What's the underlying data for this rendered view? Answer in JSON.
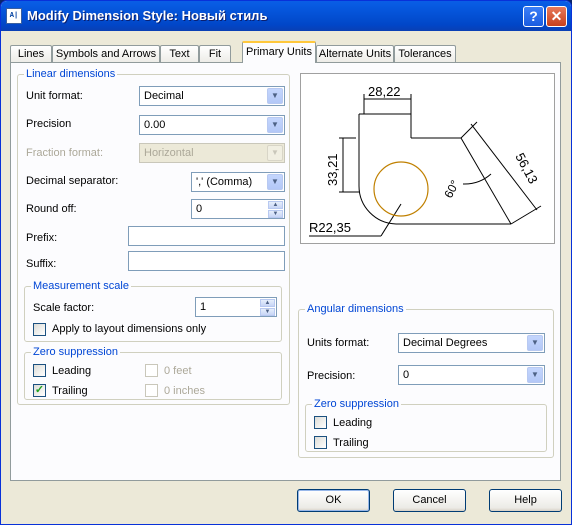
{
  "window": {
    "title": "Modify Dimension Style: Новый стиль",
    "icon": "A|",
    "help_glyph": "?",
    "close_glyph": "✕"
  },
  "tabs": [
    {
      "label": "Lines"
    },
    {
      "label": "Symbols and Arrows"
    },
    {
      "label": "Text"
    },
    {
      "label": "Fit"
    },
    {
      "label": "Primary Units",
      "active": true
    },
    {
      "label": "Alternate Units"
    },
    {
      "label": "Tolerances"
    }
  ],
  "linear": {
    "title": "Linear dimensions",
    "unit_format": {
      "label": "Unit format:",
      "value": "Decimal"
    },
    "precision": {
      "label": "Precision",
      "value": "0.00"
    },
    "fraction_format": {
      "label": "Fraction format:",
      "value": "Horizontal"
    },
    "decimal_separator": {
      "label": "Decimal separator:",
      "value": "',' (Comma)"
    },
    "round_off": {
      "label": "Round off:",
      "value": "0"
    },
    "prefix": {
      "label": "Prefix:",
      "value": ""
    },
    "suffix": {
      "label": "Suffix:",
      "value": ""
    }
  },
  "measurement_scale": {
    "title": "Measurement scale",
    "scale_factor": {
      "label": "Scale factor:",
      "value": "1"
    },
    "apply_layout": {
      "label": "Apply to layout dimensions only",
      "checked": false
    }
  },
  "zero_linear": {
    "title": "Zero suppression",
    "leading": {
      "label": "Leading",
      "checked": false
    },
    "trailing": {
      "label": "Trailing",
      "checked": true
    },
    "feet": {
      "label": "0 feet",
      "checked": false
    },
    "inches": {
      "label": "0 inches",
      "checked": false
    }
  },
  "preview": {
    "dim_top": "28,22",
    "dim_left": "33,21",
    "dim_right": "56,13",
    "angle": "60°",
    "radius": "R22,35"
  },
  "angular": {
    "title": "Angular dimensions",
    "units_format": {
      "label": "Units format:",
      "value": "Decimal Degrees"
    },
    "precision": {
      "label": "Precision:",
      "value": "0"
    }
  },
  "zero_angular": {
    "title": "Zero suppression",
    "leading": {
      "label": "Leading",
      "checked": false
    },
    "trailing": {
      "label": "Trailing",
      "checked": false
    }
  },
  "buttons": {
    "ok": "OK",
    "cancel": "Cancel",
    "help": "Help"
  },
  "icons": {
    "dropdown": "▼",
    "spin_up": "▲",
    "spin_down": "▼",
    "check": "✓"
  }
}
